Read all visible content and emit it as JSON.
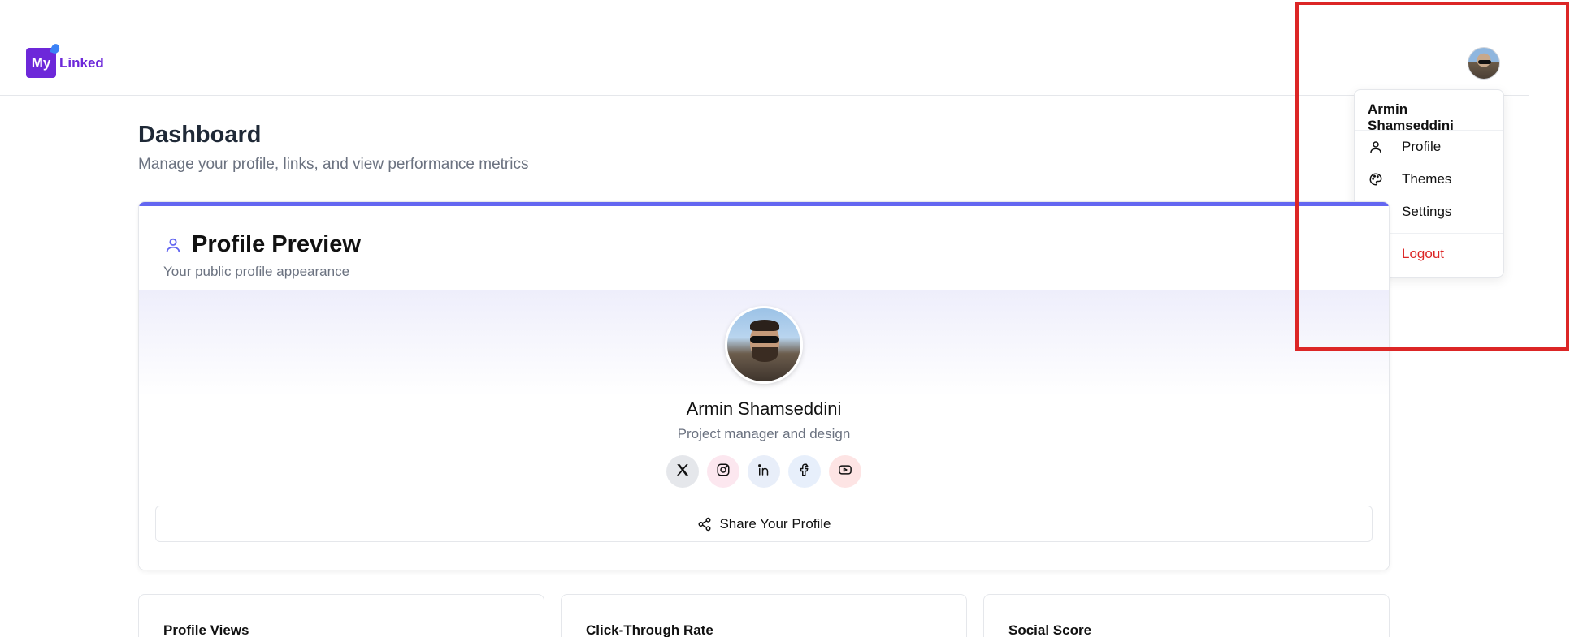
{
  "brand": {
    "logo_box": "My",
    "logo_text": "Linked"
  },
  "user_menu": {
    "name": "Armin Shamseddini",
    "items": [
      {
        "label": "Profile",
        "icon": "user-icon"
      },
      {
        "label": "Themes",
        "icon": "palette-icon"
      },
      {
        "label": "Settings",
        "icon": "gear-icon"
      }
    ],
    "logout": {
      "label": "Logout",
      "icon": "logout-icon"
    }
  },
  "dashboard": {
    "title": "Dashboard",
    "subtitle": "Manage your profile, links, and view performance metrics"
  },
  "profile_preview": {
    "title": "Profile Preview",
    "subtitle": "Your public profile appearance",
    "name": "Armin Shamseddini",
    "role": "Project manager and design",
    "socials": [
      "x-icon",
      "instagram-icon",
      "linkedin-icon",
      "facebook-icon",
      "youtube-icon"
    ],
    "share_label": "Share Your Profile"
  },
  "stats": [
    {
      "label": "Profile Views"
    },
    {
      "label": "Click-Through Rate"
    },
    {
      "label": "Social Score"
    }
  ],
  "colors": {
    "accent": "#6366f1",
    "brand": "#6d28d9",
    "danger": "#dc2626",
    "highlight_box": "#dc2626"
  }
}
